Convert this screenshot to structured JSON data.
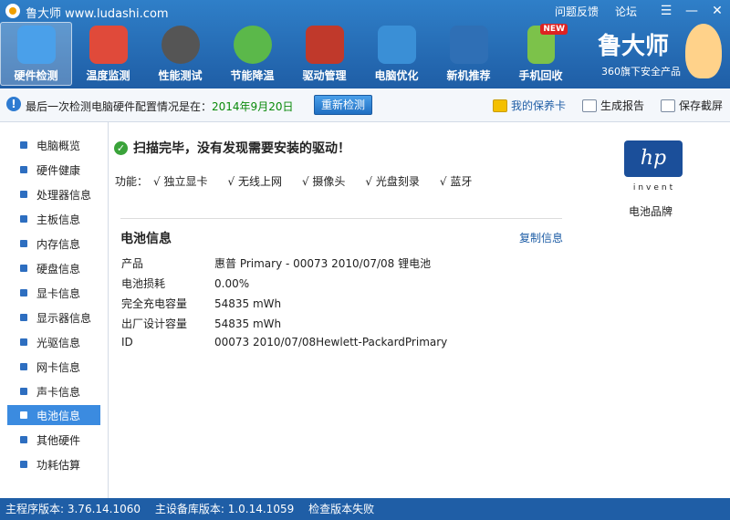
{
  "titlebar": {
    "app_title": "鲁大师 www.ludashi.com",
    "feedback": "问题反馈",
    "forum": "论坛",
    "menu_icon": "menu-icon",
    "minimize": "—",
    "close": "✕"
  },
  "nav": [
    {
      "label": "硬件检测",
      "icon": "monitor-magnifier-icon",
      "color": "#4aa0ea"
    },
    {
      "label": "温度监测",
      "icon": "thermometer-icon",
      "color": "#e04a3a"
    },
    {
      "label": "性能测试",
      "icon": "speedometer-icon",
      "color": "#555555"
    },
    {
      "label": "节能降温",
      "icon": "clover-icon",
      "color": "#5bb84a"
    },
    {
      "label": "驱动管理",
      "icon": "toolbox-icon",
      "color": "#c0392b"
    },
    {
      "label": "电脑优化",
      "icon": "monitor-broom-icon",
      "color": "#3a8fd6"
    },
    {
      "label": "新机推荐",
      "icon": "monitor-medal-icon",
      "color": "#2f6fb5"
    },
    {
      "label": "手机回收",
      "icon": "phone-recycle-icon",
      "color": "#7cc24a",
      "badge": "NEW"
    }
  ],
  "brand": {
    "name": "鲁大师",
    "subtitle": "360旗下安全产品"
  },
  "infobar": {
    "text": "最后一次检测电脑硬件配置情况是在：",
    "date": "2014年9月20日",
    "recheck": "重新检测",
    "vip_card": "我的保养卡",
    "report": "生成报告",
    "screenshot": "保存截屏"
  },
  "sidebar": {
    "items": [
      {
        "label": "电脑概览"
      },
      {
        "label": "硬件健康"
      },
      {
        "label": "处理器信息"
      },
      {
        "label": "主板信息"
      },
      {
        "label": "内存信息"
      },
      {
        "label": "硬盘信息"
      },
      {
        "label": "显卡信息"
      },
      {
        "label": "显示器信息"
      },
      {
        "label": "光驱信息"
      },
      {
        "label": "网卡信息"
      },
      {
        "label": "声卡信息"
      },
      {
        "label": "电池信息",
        "active": true
      },
      {
        "label": "其他硬件"
      },
      {
        "label": "功耗估算"
      }
    ]
  },
  "main": {
    "scan_message": "扫描完毕，没有发现需要安装的驱动！",
    "features_label": "功能：",
    "features": [
      "√ 独立显卡",
      "√ 无线上网",
      "√ 摄像头",
      "√ 光盘刻录",
      "√ 蓝牙"
    ],
    "section_title": "电池信息",
    "copy_link": "复制信息",
    "rows": [
      {
        "key": "产品",
        "value": "惠普 Primary - 00073 2010/07/08 锂电池"
      },
      {
        "key": "电池损耗",
        "value": "0.00%"
      },
      {
        "key": "完全充电容量",
        "value": "54835 mWh"
      },
      {
        "key": "出厂设计容量",
        "value": "54835 mWh"
      },
      {
        "key": "ID",
        "value": "00073 2010/07/08Hewlett-PackardPrimary"
      }
    ]
  },
  "right_panel": {
    "logo_text": "hp",
    "invent": "invent",
    "caption": "电池品牌"
  },
  "statusbar": {
    "main_version": "主程序版本: 3.76.14.1060",
    "db_version": "主设备库版本: 1.0.14.1059",
    "check_status": "检查版本失败"
  }
}
